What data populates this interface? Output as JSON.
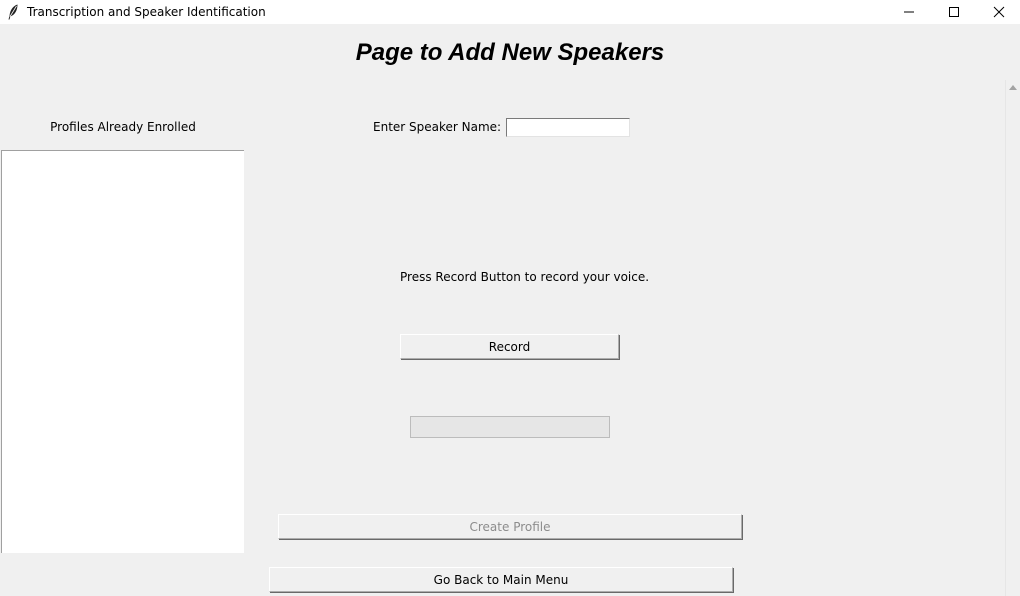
{
  "window": {
    "title": "Transcription and Speaker Identification",
    "app_icon": "feather-icon",
    "controls": [
      "minimize-icon",
      "maximize-icon",
      "close-icon"
    ]
  },
  "page": {
    "title": "Page to Add New Speakers"
  },
  "profiles": {
    "label": "Profiles Already Enrolled",
    "items": []
  },
  "speaker_name": {
    "label": "Enter Speaker Name:",
    "value": ""
  },
  "record": {
    "instruction": "Press Record Button to record your voice.",
    "button_label": "Record",
    "progress": 0
  },
  "actions": {
    "create_profile_label": "Create Profile",
    "create_profile_enabled": false,
    "back_label": "Go Back to Main Menu"
  }
}
